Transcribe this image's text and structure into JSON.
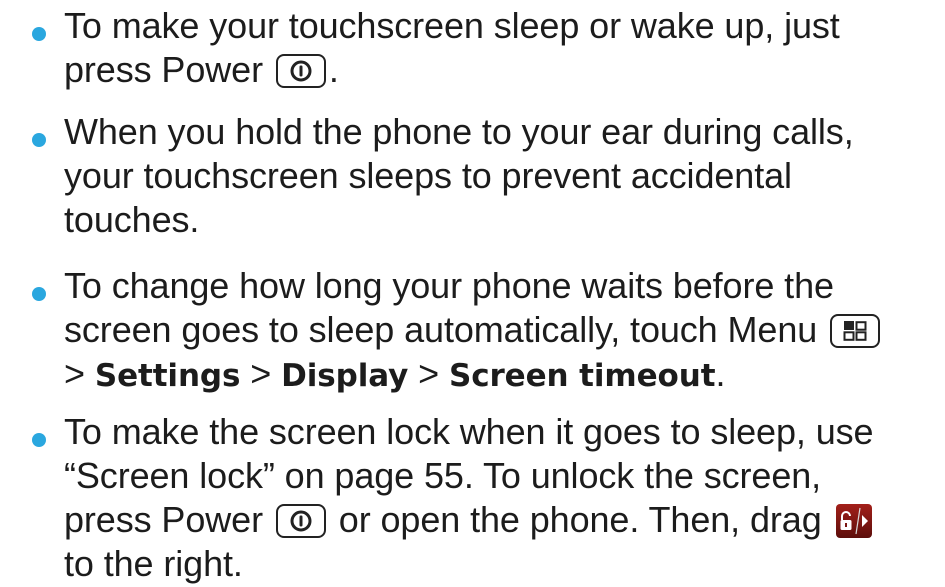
{
  "accent_color": "#2aa7df",
  "bullets": [
    {
      "line1": "To make your touchscreen sleep or wake up, just",
      "line2_pre": "press Power",
      "line2_post": "."
    },
    {
      "line1": "When you hold the phone to your ear during calls,",
      "line2": "your touchscreen sleeps to prevent accidental",
      "line3": "touches."
    },
    {
      "line1": "To change how long your phone waits before the",
      "line2_pre": "screen goes to sleep automatically, touch Menu",
      "gt": ">",
      "settings": "Settings",
      "display": "Display",
      "screen_timeout": "Screen timeout",
      "end": "."
    },
    {
      "line1": "To make the screen lock when it goes to sleep, use",
      "line2": "“Screen lock” on page 55. To unlock the screen,",
      "line3_pre": "press Power",
      "line3_mid": "or open the phone. Then, drag",
      "line4": "to the right."
    }
  ],
  "icons": {
    "power": "power-key-icon",
    "menu": "menu-key-icon",
    "unlock": "unlock-slider-icon"
  }
}
